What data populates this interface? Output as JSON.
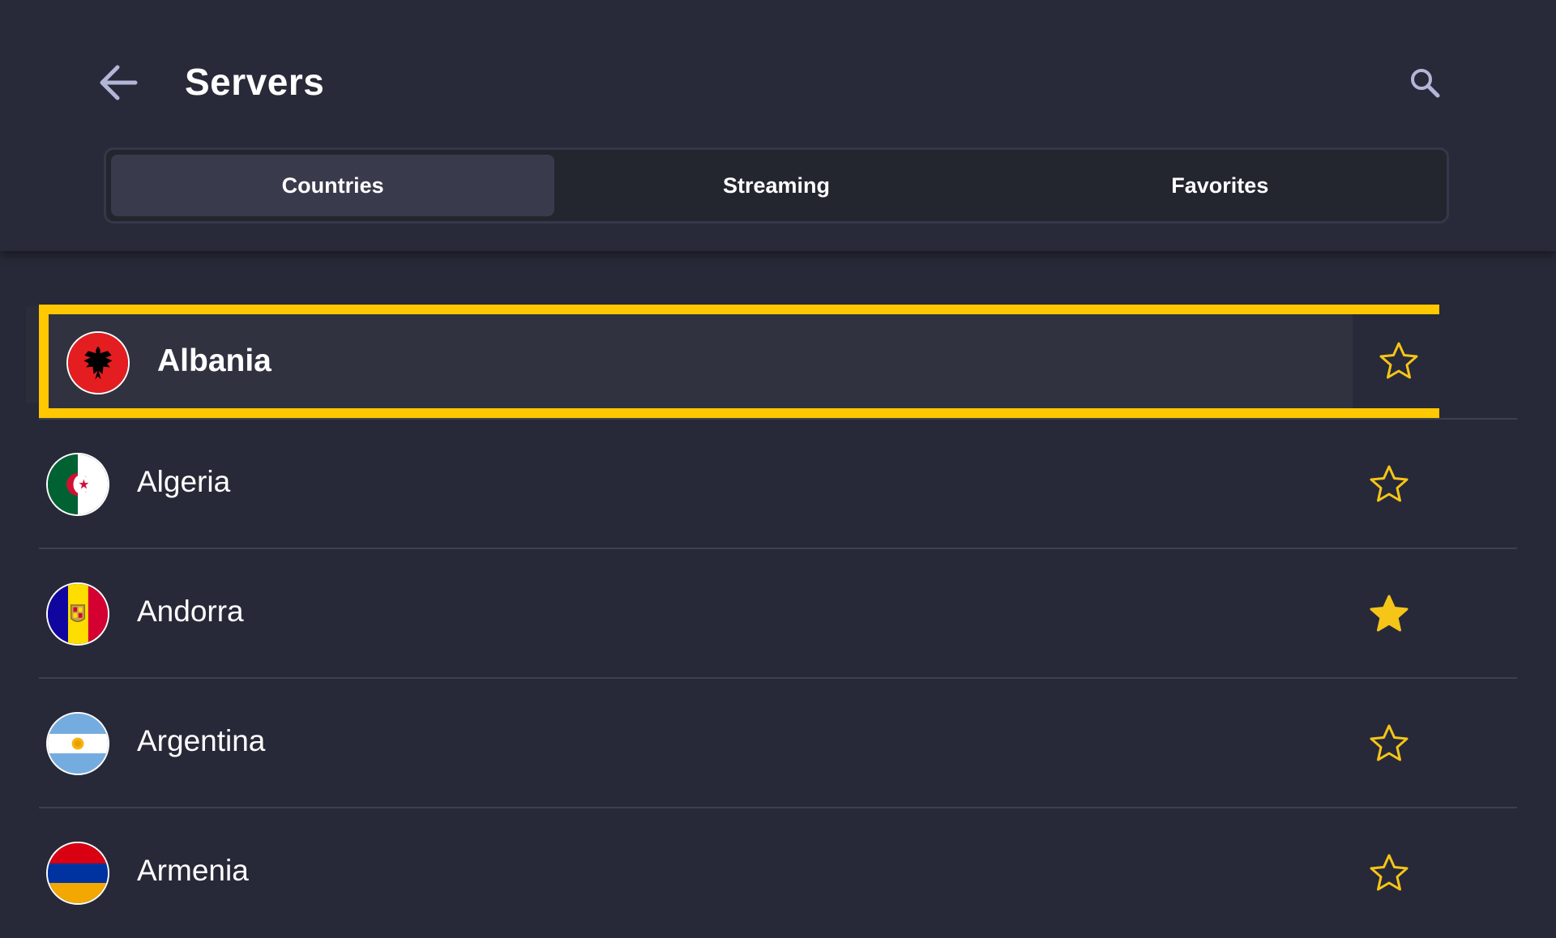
{
  "header": {
    "title": "Servers",
    "back_icon": "arrow-left-icon",
    "search_icon": "search-icon"
  },
  "tabs": [
    {
      "label": "Countries",
      "active": true
    },
    {
      "label": "Streaming",
      "active": false
    },
    {
      "label": "Favorites",
      "active": false
    }
  ],
  "countries": [
    {
      "name": "Albania",
      "flag": "albania-flag",
      "favorite": false,
      "focused": true
    },
    {
      "name": "Algeria",
      "flag": "algeria-flag",
      "favorite": false
    },
    {
      "name": "Andorra",
      "flag": "andorra-flag",
      "favorite": true
    },
    {
      "name": "Argentina",
      "flag": "argentina-flag",
      "favorite": false
    },
    {
      "name": "Armenia",
      "flag": "armenia-flag",
      "favorite": false
    }
  ],
  "colors": {
    "background": "#272938",
    "accent_focus": "#ffc800",
    "star": "#f5c518",
    "icon": "#b3b6d6"
  }
}
